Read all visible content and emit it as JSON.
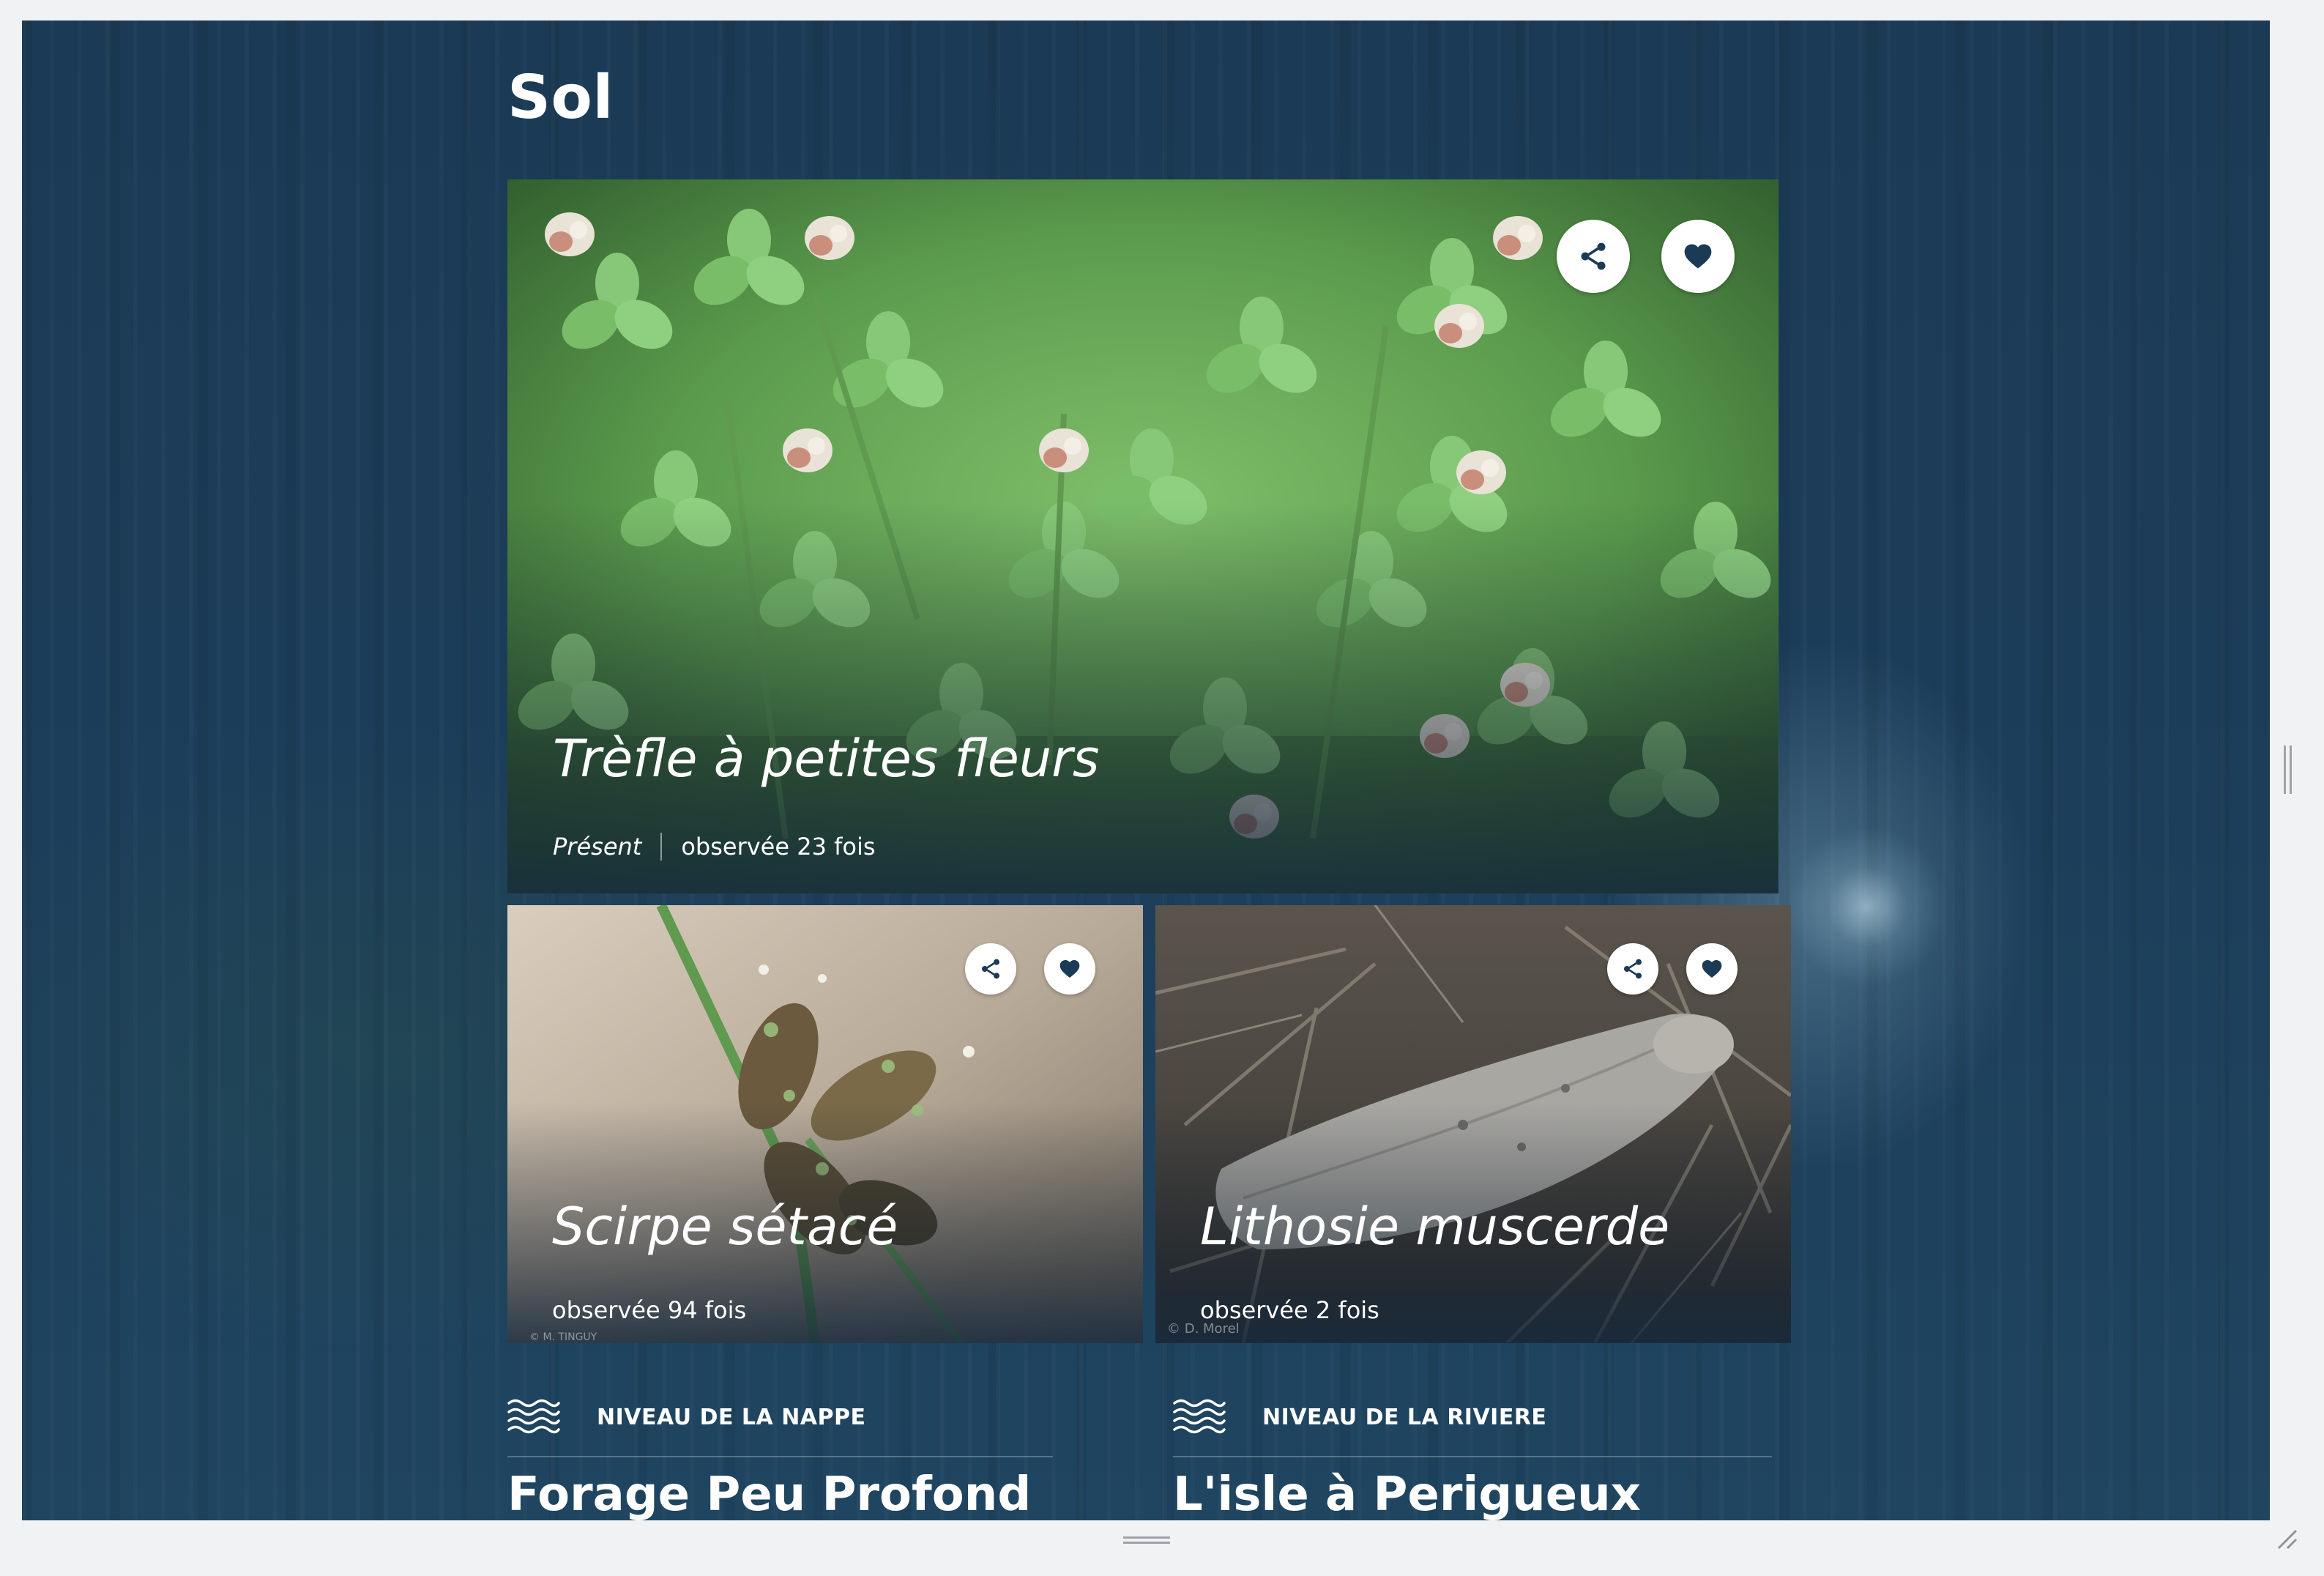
{
  "page": {
    "title": "Sol"
  },
  "cards": [
    {
      "name": "Trèfle à petites fleurs",
      "status": "Présent",
      "observed": "observée 23 fois",
      "credit": ""
    },
    {
      "name": "Scirpe sétacé",
      "observed": "observée 94 fois",
      "credit": "© M. TINGUY"
    },
    {
      "name": "Lithosie muscerde",
      "observed": "observée 2 fois",
      "credit": "© D. Morel"
    }
  ],
  "actions": {
    "share_icon": "share-icon",
    "favorite_icon": "heart-icon"
  },
  "sections": [
    {
      "label": "NIVEAU DE LA NAPPE",
      "title": "Forage Peu Profond",
      "icon": "water-waves-icon"
    },
    {
      "label": "NIVEAU DE LA RIVIERE",
      "title": "L'isle à Perigueux",
      "icon": "water-waves-icon"
    }
  ],
  "colors": {
    "background": "#1b3a55",
    "text": "#ffffff",
    "icon": "#1b3a55"
  }
}
